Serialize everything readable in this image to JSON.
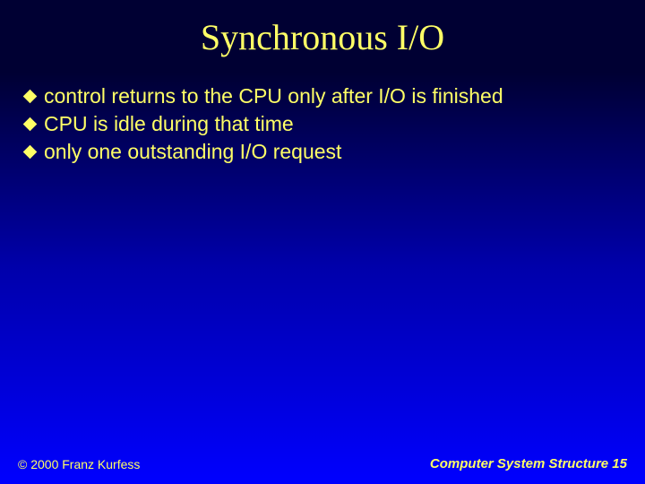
{
  "slide": {
    "title": "Synchronous I/O",
    "bullets": [
      "control returns to the CPU only after I/O is finished",
      "CPU is idle during that time",
      "only one outstanding I/O request"
    ],
    "footer_left": "© 2000 Franz Kurfess",
    "footer_right": "Computer System Structure 15"
  }
}
